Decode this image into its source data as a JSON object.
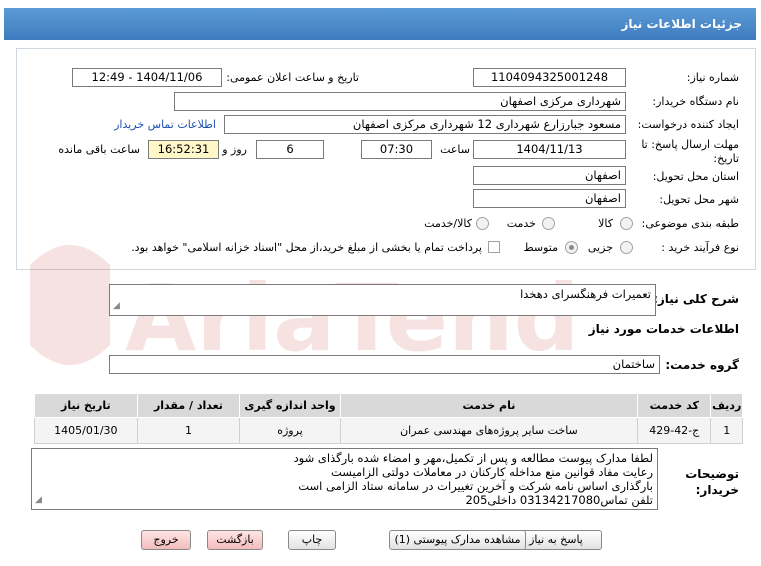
{
  "header": {
    "title": "جزئیات اطلاعات نیاز"
  },
  "form": {
    "need_number_label": "شماره نیاز:",
    "need_number": "1104094325001248",
    "announce_label": "تاریخ و ساعت اعلان عمومی:",
    "announce_value": "1404/11/06 - 12:49",
    "buyer_org_label": "نام دستگاه خریدار:",
    "buyer_org": "شهرداری مرکزی اصفهان",
    "requester_label": "ایجاد کننده درخواست:",
    "requester": "مسعود جبارزارع شهرداری 12 شهرداری مرکزی اصفهان",
    "contact_link": "اطلاعات تماس خریدار",
    "deadline_label": "مهلت ارسال پاسخ: تا تاریخ:",
    "deadline_date": "1404/11/13",
    "hour_label": "ساعت",
    "deadline_time": "07:30",
    "days_value": "6",
    "days_label": "روز و",
    "remaining_time": "16:52:31",
    "remaining_label": "ساعت باقی مانده",
    "province_label": "استان محل تحویل:",
    "province": "اصفهان",
    "city_label": "شهر محل تحویل:",
    "city": "اصفهان",
    "category_label": "طبقه بندی موضوعی:",
    "category_options": [
      "کالا",
      "خدمت",
      "کالا/خدمت"
    ],
    "process_label": "نوع فرآیند خرید :",
    "process_options": [
      "جزیی",
      "متوسط"
    ],
    "payment_note": "پرداخت تمام یا بخشی از مبلغ خرید،از محل \"اسناد خزانه اسلامی\" خواهد بود."
  },
  "summary": {
    "label": "شرح کلی نیاز:",
    "value": "تعمیرات فرهنگسرای دهخدا"
  },
  "services": {
    "section_title": "اطلاعات خدمات مورد نیاز",
    "group_label": "گروه خدمت:",
    "group_value": "ساختمان",
    "columns": [
      "ردیف",
      "کد خدمت",
      "نام خدمت",
      "واحد اندازه گیری",
      "تعداد / مقدار",
      "تاریخ نیاز"
    ],
    "rows": [
      [
        "1",
        "ج-42-429",
        "ساخت سایر پروژه‌های مهندسی عمران",
        "پروژه",
        "1",
        "1405/01/30"
      ]
    ]
  },
  "buyer_notes": {
    "label_line1": "توضیحات",
    "label_line2": "خریدار:",
    "lines": [
      "لطفا مدارک پیوست مطالعه و پس از تکمیل،مهر و امضاء شده بارگذای شود",
      "رعایت مفاد قوانین منع مداخله کارکنان در معاملات دولتی الزامیست",
      "بارگذاری اساس نامه شرکت و آخرین تغییرات در سامانه ستاد الزامی است",
      "تلفن تماس03134217080 داخلی205"
    ]
  },
  "buttons": {
    "reply": "پاسخ به نیاز",
    "view_docs": "مشاهده مدارک پیوستی (1)",
    "print": "چاپ",
    "back": "بازگشت",
    "exit": "خروج"
  },
  "watermark": {
    "text": "AriaTender.net"
  },
  "colors": {
    "header_bg": "#4a8acb",
    "link": "#1c4fb3",
    "remaining_bg": "#fff7c7",
    "watermark": "#c62828"
  }
}
